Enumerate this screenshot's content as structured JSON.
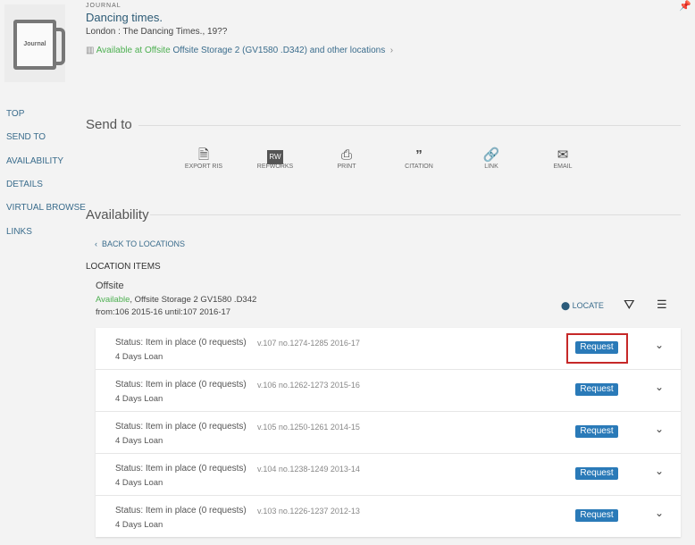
{
  "record": {
    "type": "JOURNAL",
    "title": "Dancing times.",
    "publisher": "London : The Dancing Times., 19??",
    "availability_status": "Available at Offsite",
    "availability_location": "Offsite Storage 2 (GV1580 .D342) and other locations",
    "thumbnail_label": "Journal"
  },
  "sidebar": {
    "items": [
      {
        "label": "TOP"
      },
      {
        "label": "SEND TO"
      },
      {
        "label": "AVAILABILITY"
      },
      {
        "label": "DETAILS"
      },
      {
        "label": "VIRTUAL BROWSE"
      },
      {
        "label": "LINKS"
      }
    ]
  },
  "send_to": {
    "title": "Send to",
    "actions": [
      {
        "label": "EXPORT RIS",
        "icon": "file-export-icon"
      },
      {
        "label": "REFWORKS",
        "icon": "refworks-icon",
        "glyph": "RW"
      },
      {
        "label": "PRINT",
        "icon": "print-icon"
      },
      {
        "label": "CITATION",
        "icon": "quote-icon"
      },
      {
        "label": "LINK",
        "icon": "link-icon"
      },
      {
        "label": "EMAIL",
        "icon": "email-icon"
      }
    ]
  },
  "availability": {
    "title": "Availability",
    "back_label": "BACK TO LOCATIONS",
    "location_items_label": "LOCATION ITEMS",
    "location_name": "Offsite",
    "status": "Available",
    "location_detail": ", Offsite Storage 2 GV1580 .D342",
    "holdings": "from:106 2015-16 until:107 2016-17",
    "locate_label": "LOCATE",
    "items": [
      {
        "status": "Status: Item in place (0 requests)",
        "volume": "v.107 no.1274-1285 2016-17",
        "loan": "4 Days Loan",
        "request": "Request",
        "highlighted": true
      },
      {
        "status": "Status: Item in place (0 requests)",
        "volume": "v.106 no.1262-1273 2015-16",
        "loan": "4 Days Loan",
        "request": "Request"
      },
      {
        "status": "Status: Item in place (0 requests)",
        "volume": "v.105 no.1250-1261 2014-15",
        "loan": "4 Days Loan",
        "request": "Request"
      },
      {
        "status": "Status: Item in place (0 requests)",
        "volume": "v.104 no.1238-1249 2013-14",
        "loan": "4 Days Loan",
        "request": "Request"
      },
      {
        "status": "Status: Item in place (0 requests)",
        "volume": "v.103 no.1226-1237 2012-13",
        "loan": "4 Days Loan",
        "request": "Request"
      }
    ]
  },
  "colors": {
    "available": "#4caf50",
    "link": "#3a6c8c",
    "request": "#2a7ab8",
    "highlight": "#c62828"
  }
}
